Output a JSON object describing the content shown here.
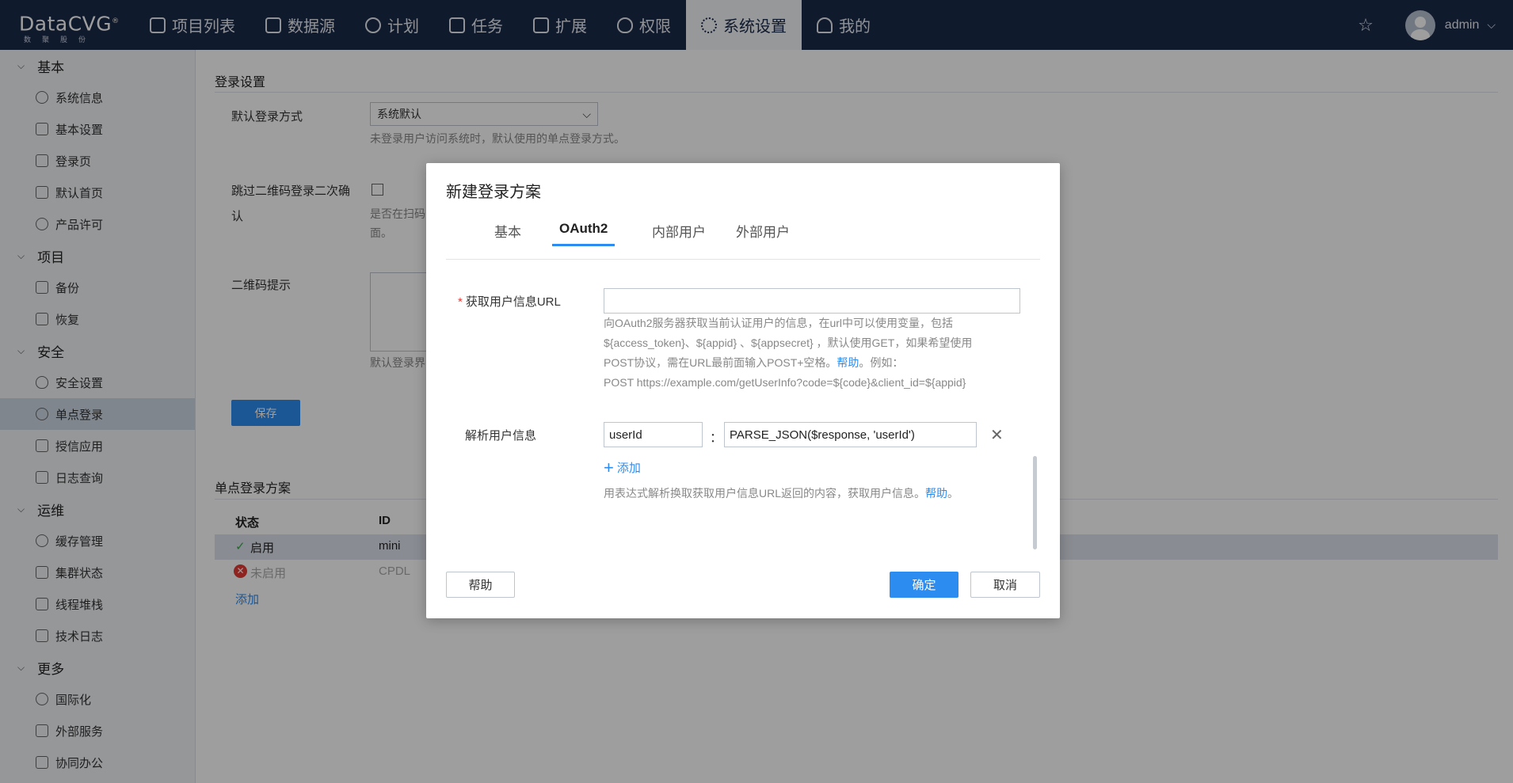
{
  "brand": {
    "name": "DataCVG",
    "registered": "®",
    "sub": "数聚股份"
  },
  "nav": {
    "items": [
      {
        "label": "项目列表"
      },
      {
        "label": "数据源"
      },
      {
        "label": "计划"
      },
      {
        "label": "任务"
      },
      {
        "label": "扩展"
      },
      {
        "label": "权限"
      },
      {
        "label": "系统设置"
      },
      {
        "label": "我的"
      }
    ],
    "active": "系统设置",
    "user": "admin",
    "star_icon": "☆",
    "chevron": "⌵"
  },
  "sidebar": {
    "chevron": "⌵",
    "sections": [
      {
        "title": "基本",
        "items": [
          "系统信息",
          "基本设置",
          "登录页",
          "默认首页",
          "产品许可"
        ]
      },
      {
        "title": "项目",
        "items": [
          "备份",
          "恢复"
        ]
      },
      {
        "title": "安全",
        "items": [
          "安全设置",
          "单点登录",
          "授信应用",
          "日志查询"
        ]
      },
      {
        "title": "运维",
        "items": [
          "缓存管理",
          "集群状态",
          "线程堆栈",
          "技术日志"
        ]
      },
      {
        "title": "更多",
        "items": [
          "国际化",
          "外部服务",
          "协同办公"
        ]
      }
    ],
    "active": "单点登录"
  },
  "main": {
    "login_settings_title": "登录设置",
    "default_login_label": "默认登录方式",
    "default_login_value": "系统默认",
    "default_login_hint": "未登录用户访问系统时，默认使用的单点登录方式。",
    "skip_qr_label_line1": "跳过二维码登录二次确",
    "skip_qr_label_line2": "认",
    "skip_qr_hint_line1": "是否在扫码",
    "skip_qr_hint_line2": "面。",
    "qr_tip_label": "二维码提示",
    "qr_tip_hint": "默认登录界",
    "save_label": "保存",
    "sso_title": "单点登录方案",
    "table": {
      "headers": [
        "状态",
        "ID"
      ],
      "rows": [
        {
          "status": "启用",
          "id": "mini",
          "enabled": true
        },
        {
          "status": "未启用",
          "id": "CPDL",
          "enabled": false
        }
      ],
      "add_label": "添加"
    }
  },
  "dialog": {
    "title": "新建登录方案",
    "tabs": [
      "基本",
      "OAuth2",
      "内部用户",
      "外部用户"
    ],
    "active_tab": "OAuth2",
    "userinfo_url": {
      "required_mark": "*",
      "label": "获取用户信息URL",
      "value": "",
      "hint_line1": "向OAuth2服务器获取当前认证用户的信息，在url中可以使用变量，包括",
      "hint_line2": "${access_token}、${appid} 、${appsecret} ，默认使用GET，如果希望使用",
      "hint_line3_pre": "POST协议，需在URL最前面输入POST+空格。",
      "hint_line3_link": "帮助",
      "hint_line3_post": "。例如：",
      "hint_line4": "POST https://example.com/getUserInfo?code=${code}&client_id=${appid}"
    },
    "parse_userinfo": {
      "label": "解析用户信息",
      "key": "userId",
      "separator": "：",
      "expression": "PARSE_JSON($response, 'userId')",
      "remove_icon": "✕",
      "add_icon": "+",
      "add_label": "添加",
      "hint_pre": "用表达式解析换取获取用户信息URL返回的内容，获取用户信息。",
      "hint_link": "帮助",
      "hint_post": "。"
    },
    "buttons": {
      "help": "帮助",
      "ok": "确定",
      "cancel": "取消"
    }
  },
  "colors": {
    "nav_bg": "#1b2a4a",
    "accent": "#2d8cf0",
    "sidebar_bg": "#f2f4f7",
    "active_item": "#cdd8e6",
    "ok_green": "#3aa54b",
    "error_red": "#e53935"
  }
}
